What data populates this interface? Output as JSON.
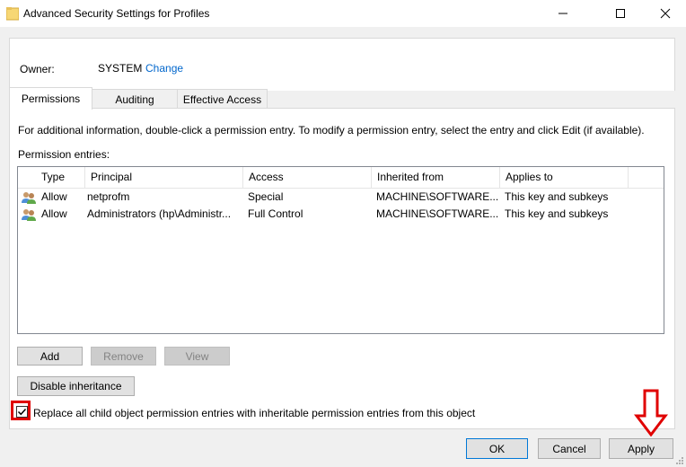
{
  "window": {
    "title": "Advanced Security Settings for Profiles",
    "controls": [
      "minimize-icon",
      "maximize-icon",
      "close-icon"
    ]
  },
  "owner": {
    "label": "Owner:",
    "value": "SYSTEM",
    "change_link": "Change"
  },
  "tabs": [
    {
      "label": "Permissions",
      "active": true
    },
    {
      "label": "Auditing",
      "active": false
    },
    {
      "label": "Effective Access",
      "active": false
    }
  ],
  "permissions": {
    "info": "For additional information, double-click a permission entry. To modify a permission entry, select the entry and click Edit (if available).",
    "entries_label": "Permission entries:",
    "columns": [
      "Type",
      "Principal",
      "Access",
      "Inherited from",
      "Applies to"
    ],
    "rows": [
      {
        "icon": "users-icon",
        "type": "Allow",
        "principal": "netprofm",
        "access": "Special",
        "inherited_from": "MACHINE\\SOFTWARE...",
        "applies_to": "This key and subkeys"
      },
      {
        "icon": "users-icon",
        "type": "Allow",
        "principal": "Administrators (hp\\Administr...",
        "access": "Full Control",
        "inherited_from": "MACHINE\\SOFTWARE...",
        "applies_to": "This key and subkeys"
      }
    ],
    "buttons": {
      "add": "Add",
      "remove": "Remove",
      "view": "View",
      "disable_inheritance": "Disable inheritance"
    },
    "replace_checkbox": {
      "checked": true,
      "label": "Replace all child object permission entries with inheritable permission entries from this object"
    }
  },
  "dialog_buttons": {
    "ok": "OK",
    "cancel": "Cancel",
    "apply": "Apply"
  },
  "colors": {
    "link": "#0066cc",
    "annotation_red": "#e00000",
    "default_button_border": "#0078d7"
  }
}
